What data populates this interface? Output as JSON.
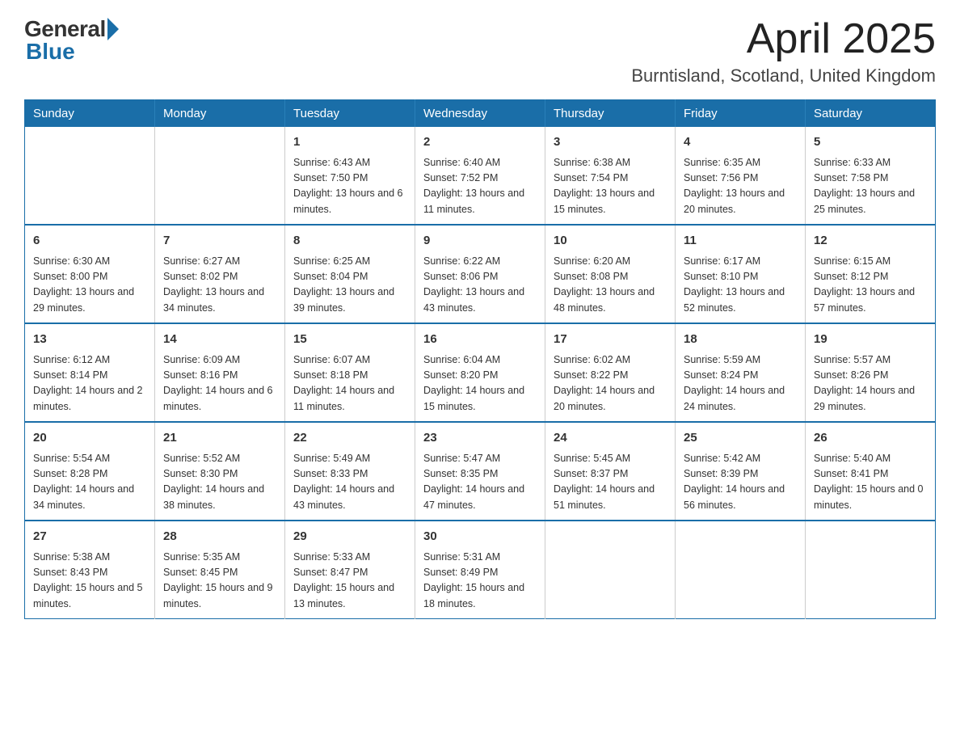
{
  "logo": {
    "general": "General",
    "blue": "Blue"
  },
  "title": "April 2025",
  "subtitle": "Burntisland, Scotland, United Kingdom",
  "weekdays": [
    "Sunday",
    "Monday",
    "Tuesday",
    "Wednesday",
    "Thursday",
    "Friday",
    "Saturday"
  ],
  "weeks": [
    [
      {
        "day": "",
        "sunrise": "",
        "sunset": "",
        "daylight": ""
      },
      {
        "day": "",
        "sunrise": "",
        "sunset": "",
        "daylight": ""
      },
      {
        "day": "1",
        "sunrise": "Sunrise: 6:43 AM",
        "sunset": "Sunset: 7:50 PM",
        "daylight": "Daylight: 13 hours and 6 minutes."
      },
      {
        "day": "2",
        "sunrise": "Sunrise: 6:40 AM",
        "sunset": "Sunset: 7:52 PM",
        "daylight": "Daylight: 13 hours and 11 minutes."
      },
      {
        "day": "3",
        "sunrise": "Sunrise: 6:38 AM",
        "sunset": "Sunset: 7:54 PM",
        "daylight": "Daylight: 13 hours and 15 minutes."
      },
      {
        "day": "4",
        "sunrise": "Sunrise: 6:35 AM",
        "sunset": "Sunset: 7:56 PM",
        "daylight": "Daylight: 13 hours and 20 minutes."
      },
      {
        "day": "5",
        "sunrise": "Sunrise: 6:33 AM",
        "sunset": "Sunset: 7:58 PM",
        "daylight": "Daylight: 13 hours and 25 minutes."
      }
    ],
    [
      {
        "day": "6",
        "sunrise": "Sunrise: 6:30 AM",
        "sunset": "Sunset: 8:00 PM",
        "daylight": "Daylight: 13 hours and 29 minutes."
      },
      {
        "day": "7",
        "sunrise": "Sunrise: 6:27 AM",
        "sunset": "Sunset: 8:02 PM",
        "daylight": "Daylight: 13 hours and 34 minutes."
      },
      {
        "day": "8",
        "sunrise": "Sunrise: 6:25 AM",
        "sunset": "Sunset: 8:04 PM",
        "daylight": "Daylight: 13 hours and 39 minutes."
      },
      {
        "day": "9",
        "sunrise": "Sunrise: 6:22 AM",
        "sunset": "Sunset: 8:06 PM",
        "daylight": "Daylight: 13 hours and 43 minutes."
      },
      {
        "day": "10",
        "sunrise": "Sunrise: 6:20 AM",
        "sunset": "Sunset: 8:08 PM",
        "daylight": "Daylight: 13 hours and 48 minutes."
      },
      {
        "day": "11",
        "sunrise": "Sunrise: 6:17 AM",
        "sunset": "Sunset: 8:10 PM",
        "daylight": "Daylight: 13 hours and 52 minutes."
      },
      {
        "day": "12",
        "sunrise": "Sunrise: 6:15 AM",
        "sunset": "Sunset: 8:12 PM",
        "daylight": "Daylight: 13 hours and 57 minutes."
      }
    ],
    [
      {
        "day": "13",
        "sunrise": "Sunrise: 6:12 AM",
        "sunset": "Sunset: 8:14 PM",
        "daylight": "Daylight: 14 hours and 2 minutes."
      },
      {
        "day": "14",
        "sunrise": "Sunrise: 6:09 AM",
        "sunset": "Sunset: 8:16 PM",
        "daylight": "Daylight: 14 hours and 6 minutes."
      },
      {
        "day": "15",
        "sunrise": "Sunrise: 6:07 AM",
        "sunset": "Sunset: 8:18 PM",
        "daylight": "Daylight: 14 hours and 11 minutes."
      },
      {
        "day": "16",
        "sunrise": "Sunrise: 6:04 AM",
        "sunset": "Sunset: 8:20 PM",
        "daylight": "Daylight: 14 hours and 15 minutes."
      },
      {
        "day": "17",
        "sunrise": "Sunrise: 6:02 AM",
        "sunset": "Sunset: 8:22 PM",
        "daylight": "Daylight: 14 hours and 20 minutes."
      },
      {
        "day": "18",
        "sunrise": "Sunrise: 5:59 AM",
        "sunset": "Sunset: 8:24 PM",
        "daylight": "Daylight: 14 hours and 24 minutes."
      },
      {
        "day": "19",
        "sunrise": "Sunrise: 5:57 AM",
        "sunset": "Sunset: 8:26 PM",
        "daylight": "Daylight: 14 hours and 29 minutes."
      }
    ],
    [
      {
        "day": "20",
        "sunrise": "Sunrise: 5:54 AM",
        "sunset": "Sunset: 8:28 PM",
        "daylight": "Daylight: 14 hours and 34 minutes."
      },
      {
        "day": "21",
        "sunrise": "Sunrise: 5:52 AM",
        "sunset": "Sunset: 8:30 PM",
        "daylight": "Daylight: 14 hours and 38 minutes."
      },
      {
        "day": "22",
        "sunrise": "Sunrise: 5:49 AM",
        "sunset": "Sunset: 8:33 PM",
        "daylight": "Daylight: 14 hours and 43 minutes."
      },
      {
        "day": "23",
        "sunrise": "Sunrise: 5:47 AM",
        "sunset": "Sunset: 8:35 PM",
        "daylight": "Daylight: 14 hours and 47 minutes."
      },
      {
        "day": "24",
        "sunrise": "Sunrise: 5:45 AM",
        "sunset": "Sunset: 8:37 PM",
        "daylight": "Daylight: 14 hours and 51 minutes."
      },
      {
        "day": "25",
        "sunrise": "Sunrise: 5:42 AM",
        "sunset": "Sunset: 8:39 PM",
        "daylight": "Daylight: 14 hours and 56 minutes."
      },
      {
        "day": "26",
        "sunrise": "Sunrise: 5:40 AM",
        "sunset": "Sunset: 8:41 PM",
        "daylight": "Daylight: 15 hours and 0 minutes."
      }
    ],
    [
      {
        "day": "27",
        "sunrise": "Sunrise: 5:38 AM",
        "sunset": "Sunset: 8:43 PM",
        "daylight": "Daylight: 15 hours and 5 minutes."
      },
      {
        "day": "28",
        "sunrise": "Sunrise: 5:35 AM",
        "sunset": "Sunset: 8:45 PM",
        "daylight": "Daylight: 15 hours and 9 minutes."
      },
      {
        "day": "29",
        "sunrise": "Sunrise: 5:33 AM",
        "sunset": "Sunset: 8:47 PM",
        "daylight": "Daylight: 15 hours and 13 minutes."
      },
      {
        "day": "30",
        "sunrise": "Sunrise: 5:31 AM",
        "sunset": "Sunset: 8:49 PM",
        "daylight": "Daylight: 15 hours and 18 minutes."
      },
      {
        "day": "",
        "sunrise": "",
        "sunset": "",
        "daylight": ""
      },
      {
        "day": "",
        "sunrise": "",
        "sunset": "",
        "daylight": ""
      },
      {
        "day": "",
        "sunrise": "",
        "sunset": "",
        "daylight": ""
      }
    ]
  ]
}
